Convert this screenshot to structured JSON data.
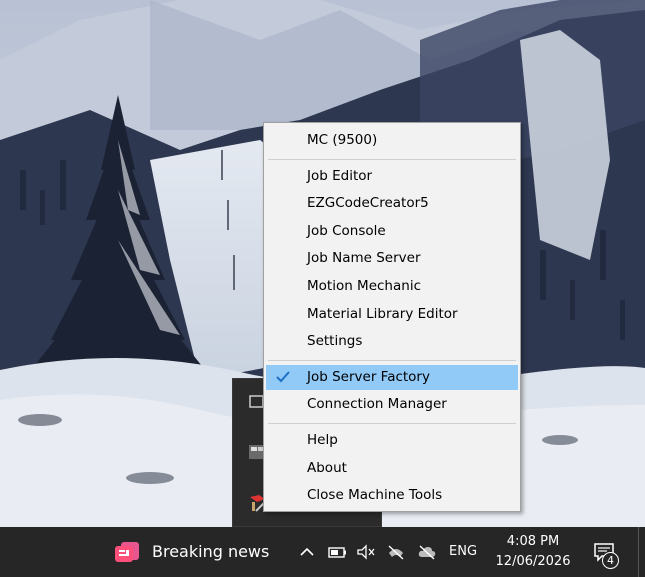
{
  "menu": {
    "groups": [
      {
        "items": [
          {
            "label": "MC (9500)",
            "checked": false
          }
        ]
      },
      {
        "items": [
          {
            "label": "Job Editor",
            "checked": false
          },
          {
            "label": "EZGCodeCreator5",
            "checked": false
          },
          {
            "label": "Job Console",
            "checked": false
          },
          {
            "label": "Job Name Server",
            "checked": false
          },
          {
            "label": "Motion Mechanic",
            "checked": false
          },
          {
            "label": "Material Library Editor",
            "checked": false
          },
          {
            "label": "Settings",
            "checked": false
          }
        ]
      },
      {
        "items": [
          {
            "label": "Job Server Factory",
            "checked": true
          },
          {
            "label": "Connection Manager",
            "checked": false
          }
        ]
      },
      {
        "items": [
          {
            "label": "Help",
            "checked": false
          },
          {
            "label": "About",
            "checked": false
          },
          {
            "label": "Close Machine Tools",
            "checked": false
          }
        ]
      }
    ]
  },
  "taskbar": {
    "news_label": "Breaking news",
    "language": "ENG",
    "time": "4:08 PM",
    "date": "12/06/2026",
    "notification_count": "4",
    "icons": [
      "news-icon",
      "chevron-up-icon",
      "battery-icon",
      "volume-muted-icon",
      "network-disconnected-icon",
      "cloud-offline-icon",
      "action-center-icon"
    ]
  },
  "colors": {
    "taskbar_bg": "#262626",
    "menu_bg": "#f2f2f2",
    "menu_highlight": "#91c9f7",
    "check": "#1e6fc6"
  }
}
